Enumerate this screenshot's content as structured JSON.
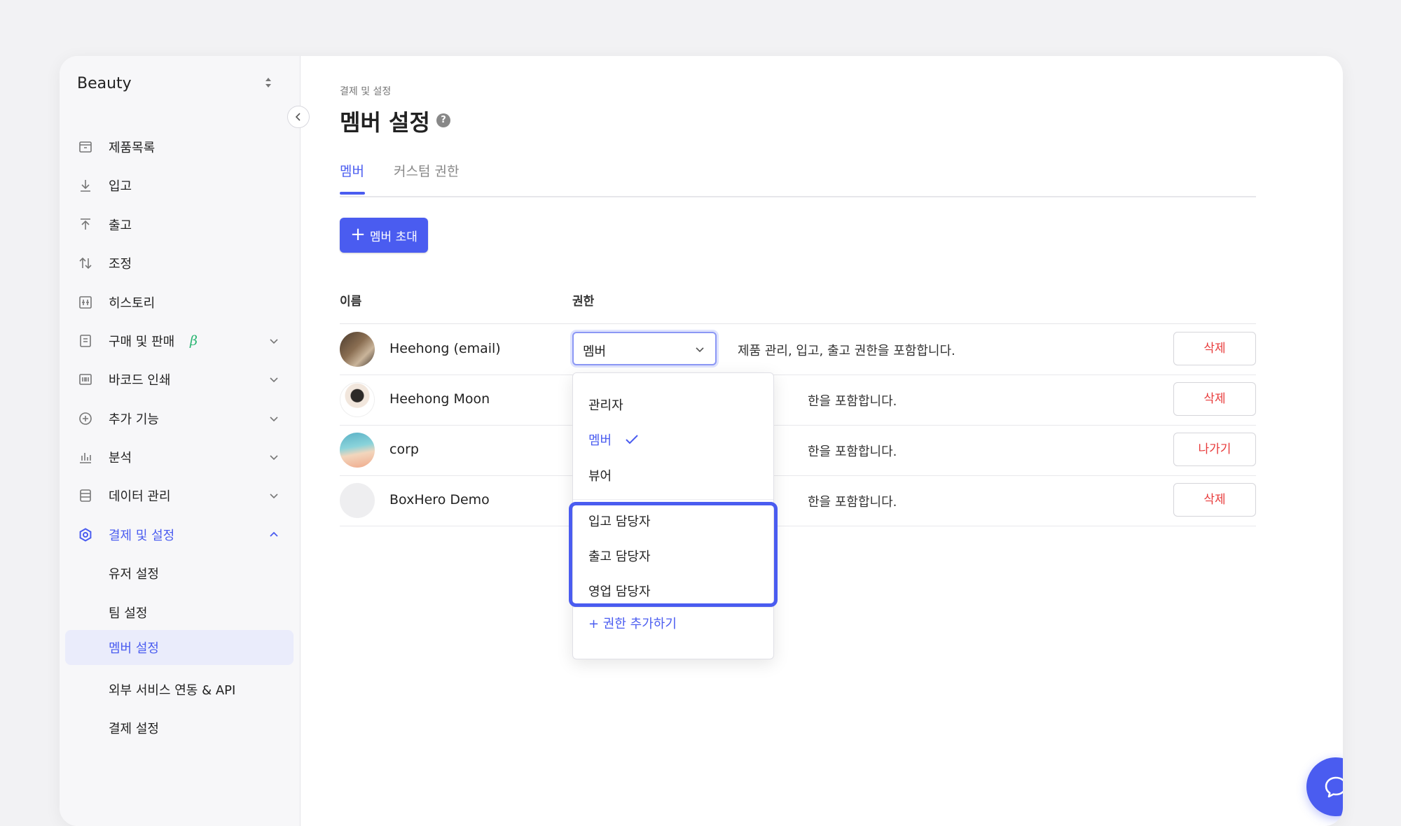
{
  "sidebar": {
    "workspace": "Beauty",
    "items": [
      {
        "label": "제품목록",
        "icon": "box-icon"
      },
      {
        "label": "입고",
        "icon": "arrow-down-icon"
      },
      {
        "label": "출고",
        "icon": "arrow-up-icon"
      },
      {
        "label": "조정",
        "icon": "swap-icon"
      },
      {
        "label": "히스토리",
        "icon": "history-icon"
      },
      {
        "label": "구매 및 판매",
        "icon": "document-icon",
        "badge": "β"
      },
      {
        "label": "바코드 인쇄",
        "icon": "barcode-icon"
      },
      {
        "label": "추가 기능",
        "icon": "plus-circle-icon"
      },
      {
        "label": "분석",
        "icon": "bar-chart-icon"
      },
      {
        "label": "데이터 관리",
        "icon": "database-icon"
      },
      {
        "label": "결제 및 설정",
        "icon": "gear-icon"
      }
    ],
    "subitems": [
      {
        "label": "유저 설정"
      },
      {
        "label": "팀 설정"
      },
      {
        "label": "멤버 설정"
      },
      {
        "label": "외부 서비스 연동 & API"
      },
      {
        "label": "결제 설정"
      }
    ]
  },
  "main": {
    "breadcrumb": "결제 및 설정",
    "title": "멤버 설정",
    "help": "?",
    "tabs": [
      {
        "label": "멤버"
      },
      {
        "label": "커스텀 권한"
      }
    ],
    "invite_label": "멤버 초대",
    "columns": {
      "name": "이름",
      "permission": "권한"
    },
    "rows": [
      {
        "name": "Heehong (email)",
        "permission": "멤버",
        "desc": "제품 관리, 입고, 출고 권한을 포함합니다.",
        "action": "삭제"
      },
      {
        "name": "Heehong Moon",
        "desc": "한을 포함합니다.",
        "action": "삭제"
      },
      {
        "name": "corp",
        "desc": "한을 포함합니다.",
        "action": "나가기"
      },
      {
        "name": "BoxHero Demo",
        "desc": "한을 포함합니다.",
        "action": "삭제"
      }
    ],
    "dropdown": {
      "options": [
        "관리자",
        "멤버",
        "뷰어"
      ],
      "custom_options": [
        "입고 담당자",
        "출고 담당자",
        "영업 담당자"
      ],
      "add_label": "+ 권한 추가하기"
    }
  },
  "colors": {
    "accent": "#4a5cf0",
    "danger": "#e83a3a",
    "beta": "#2bb673"
  }
}
